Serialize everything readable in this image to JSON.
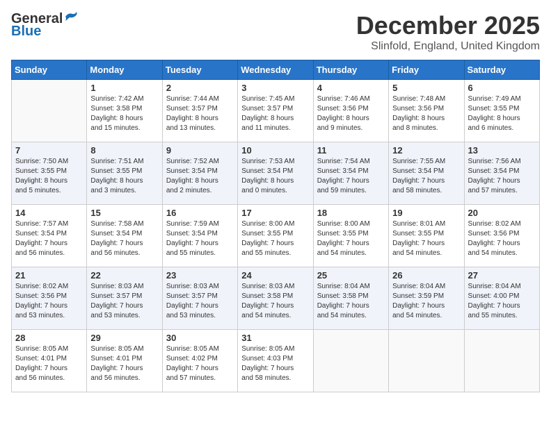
{
  "header": {
    "logo_general": "General",
    "logo_blue": "Blue",
    "month_title": "December 2025",
    "subtitle": "Slinfold, England, United Kingdom"
  },
  "weekdays": [
    "Sunday",
    "Monday",
    "Tuesday",
    "Wednesday",
    "Thursday",
    "Friday",
    "Saturday"
  ],
  "weeks": [
    [
      {
        "day": "",
        "info": ""
      },
      {
        "day": "1",
        "info": "Sunrise: 7:42 AM\nSunset: 3:58 PM\nDaylight: 8 hours\nand 15 minutes."
      },
      {
        "day": "2",
        "info": "Sunrise: 7:44 AM\nSunset: 3:57 PM\nDaylight: 8 hours\nand 13 minutes."
      },
      {
        "day": "3",
        "info": "Sunrise: 7:45 AM\nSunset: 3:57 PM\nDaylight: 8 hours\nand 11 minutes."
      },
      {
        "day": "4",
        "info": "Sunrise: 7:46 AM\nSunset: 3:56 PM\nDaylight: 8 hours\nand 9 minutes."
      },
      {
        "day": "5",
        "info": "Sunrise: 7:48 AM\nSunset: 3:56 PM\nDaylight: 8 hours\nand 8 minutes."
      },
      {
        "day": "6",
        "info": "Sunrise: 7:49 AM\nSunset: 3:55 PM\nDaylight: 8 hours\nand 6 minutes."
      }
    ],
    [
      {
        "day": "7",
        "info": "Sunrise: 7:50 AM\nSunset: 3:55 PM\nDaylight: 8 hours\nand 5 minutes."
      },
      {
        "day": "8",
        "info": "Sunrise: 7:51 AM\nSunset: 3:55 PM\nDaylight: 8 hours\nand 3 minutes."
      },
      {
        "day": "9",
        "info": "Sunrise: 7:52 AM\nSunset: 3:54 PM\nDaylight: 8 hours\nand 2 minutes."
      },
      {
        "day": "10",
        "info": "Sunrise: 7:53 AM\nSunset: 3:54 PM\nDaylight: 8 hours\nand 0 minutes."
      },
      {
        "day": "11",
        "info": "Sunrise: 7:54 AM\nSunset: 3:54 PM\nDaylight: 7 hours\nand 59 minutes."
      },
      {
        "day": "12",
        "info": "Sunrise: 7:55 AM\nSunset: 3:54 PM\nDaylight: 7 hours\nand 58 minutes."
      },
      {
        "day": "13",
        "info": "Sunrise: 7:56 AM\nSunset: 3:54 PM\nDaylight: 7 hours\nand 57 minutes."
      }
    ],
    [
      {
        "day": "14",
        "info": "Sunrise: 7:57 AM\nSunset: 3:54 PM\nDaylight: 7 hours\nand 56 minutes."
      },
      {
        "day": "15",
        "info": "Sunrise: 7:58 AM\nSunset: 3:54 PM\nDaylight: 7 hours\nand 56 minutes."
      },
      {
        "day": "16",
        "info": "Sunrise: 7:59 AM\nSunset: 3:54 PM\nDaylight: 7 hours\nand 55 minutes."
      },
      {
        "day": "17",
        "info": "Sunrise: 8:00 AM\nSunset: 3:55 PM\nDaylight: 7 hours\nand 55 minutes."
      },
      {
        "day": "18",
        "info": "Sunrise: 8:00 AM\nSunset: 3:55 PM\nDaylight: 7 hours\nand 54 minutes."
      },
      {
        "day": "19",
        "info": "Sunrise: 8:01 AM\nSunset: 3:55 PM\nDaylight: 7 hours\nand 54 minutes."
      },
      {
        "day": "20",
        "info": "Sunrise: 8:02 AM\nSunset: 3:56 PM\nDaylight: 7 hours\nand 54 minutes."
      }
    ],
    [
      {
        "day": "21",
        "info": "Sunrise: 8:02 AM\nSunset: 3:56 PM\nDaylight: 7 hours\nand 53 minutes."
      },
      {
        "day": "22",
        "info": "Sunrise: 8:03 AM\nSunset: 3:57 PM\nDaylight: 7 hours\nand 53 minutes."
      },
      {
        "day": "23",
        "info": "Sunrise: 8:03 AM\nSunset: 3:57 PM\nDaylight: 7 hours\nand 53 minutes."
      },
      {
        "day": "24",
        "info": "Sunrise: 8:03 AM\nSunset: 3:58 PM\nDaylight: 7 hours\nand 54 minutes."
      },
      {
        "day": "25",
        "info": "Sunrise: 8:04 AM\nSunset: 3:58 PM\nDaylight: 7 hours\nand 54 minutes."
      },
      {
        "day": "26",
        "info": "Sunrise: 8:04 AM\nSunset: 3:59 PM\nDaylight: 7 hours\nand 54 minutes."
      },
      {
        "day": "27",
        "info": "Sunrise: 8:04 AM\nSunset: 4:00 PM\nDaylight: 7 hours\nand 55 minutes."
      }
    ],
    [
      {
        "day": "28",
        "info": "Sunrise: 8:05 AM\nSunset: 4:01 PM\nDaylight: 7 hours\nand 56 minutes."
      },
      {
        "day": "29",
        "info": "Sunrise: 8:05 AM\nSunset: 4:01 PM\nDaylight: 7 hours\nand 56 minutes."
      },
      {
        "day": "30",
        "info": "Sunrise: 8:05 AM\nSunset: 4:02 PM\nDaylight: 7 hours\nand 57 minutes."
      },
      {
        "day": "31",
        "info": "Sunrise: 8:05 AM\nSunset: 4:03 PM\nDaylight: 7 hours\nand 58 minutes."
      },
      {
        "day": "",
        "info": ""
      },
      {
        "day": "",
        "info": ""
      },
      {
        "day": "",
        "info": ""
      }
    ]
  ]
}
